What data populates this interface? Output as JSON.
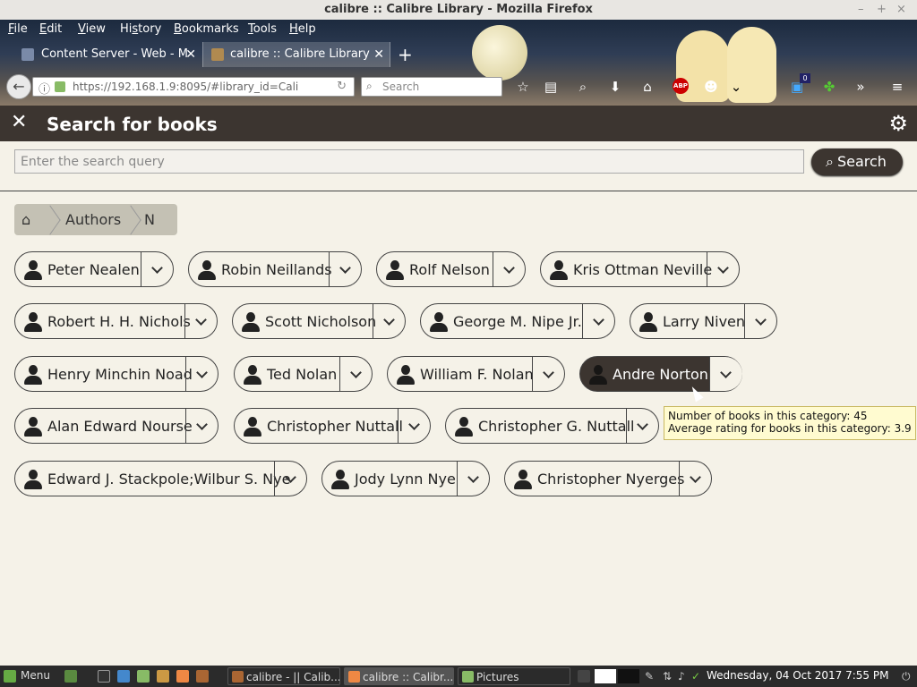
{
  "window": {
    "title": "calibre :: Calibre Library - Mozilla Firefox",
    "controls": [
      "–",
      "+",
      "×"
    ]
  },
  "menubar": [
    {
      "label": "File",
      "ul": "F",
      "rest": "ile"
    },
    {
      "label": "Edit",
      "ul": "E",
      "rest": "dit"
    },
    {
      "label": "View",
      "ul": "V",
      "rest": "iew"
    },
    {
      "label": "History",
      "ul": "H",
      "pre": "",
      "rest": "istory"
    },
    {
      "label": "Bookmarks",
      "ul": "B",
      "rest": "ookmarks"
    },
    {
      "label": "Tools",
      "ul": "T",
      "rest": "ools"
    },
    {
      "label": "Help",
      "ul": "H",
      "rest": "elp"
    }
  ],
  "tabs": [
    {
      "label": "Content Server - Web - M",
      "active": false
    },
    {
      "label": "calibre :: Calibre Library",
      "active": true
    }
  ],
  "nav": {
    "url_host": "https://192.168.1.9",
    "url_rest": ":8095/#library_id=Cali",
    "search_placeholder": "Search",
    "badge": "0",
    "abp": "ABP"
  },
  "calibre": {
    "header_title": "Search for books",
    "search_placeholder": "Enter the search query",
    "search_button": "Search",
    "breadcrumb": [
      "Authors",
      "N"
    ]
  },
  "authors": [
    {
      "name": "Peter Nealen",
      "highlighted": false
    },
    {
      "name": "Robin Neillands",
      "highlighted": false
    },
    {
      "name": "Rolf Nelson",
      "highlighted": false
    },
    {
      "name": "Kris Ottman Neville",
      "highlighted": false
    },
    {
      "name": "Robert H. H. Nichols",
      "highlighted": false
    },
    {
      "name": "Scott Nicholson",
      "highlighted": false
    },
    {
      "name": "George M. Nipe Jr.",
      "highlighted": false
    },
    {
      "name": "Larry Niven",
      "highlighted": false
    },
    {
      "name": "Henry Minchin Noad",
      "highlighted": false
    },
    {
      "name": "Ted Nolan",
      "highlighted": false
    },
    {
      "name": "William F. Nolan",
      "highlighted": false
    },
    {
      "name": "Andre Norton",
      "highlighted": true
    },
    {
      "name": "Alan Edward Nourse",
      "highlighted": false
    },
    {
      "name": "Christopher Nuttall",
      "highlighted": false
    },
    {
      "name": "Christopher G. Nuttall",
      "highlighted": false
    },
    {
      "name": "Edward J. Stackpole;Wilbur S. Nye",
      "highlighted": false
    },
    {
      "name": "Jody Lynn Nye",
      "highlighted": false
    },
    {
      "name": "Christopher Nyerges",
      "highlighted": false
    }
  ],
  "tooltip": {
    "line1": "Number of books in this category: 45",
    "line2": "Average rating for books in this category: 3.9"
  },
  "taskbar": {
    "menu_label": "Menu",
    "tasks": [
      {
        "label": "calibre - || Calib...",
        "active": false
      },
      {
        "label": "calibre :: Calibr...",
        "active": true
      },
      {
        "label": "Pictures",
        "active": false
      }
    ],
    "clock": "Wednesday, 04 Oct 2017  7:55 PM"
  },
  "colors": {
    "header_bg": "#3c3530",
    "page_bg": "#f5f2e8",
    "tooltip_bg": "#fffbd0"
  }
}
